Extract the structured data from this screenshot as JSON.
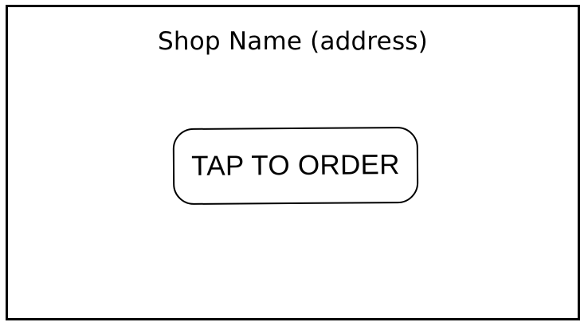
{
  "screen": {
    "title": "Shop Name (address)",
    "order_button_label": "TAP TO ORDER"
  }
}
